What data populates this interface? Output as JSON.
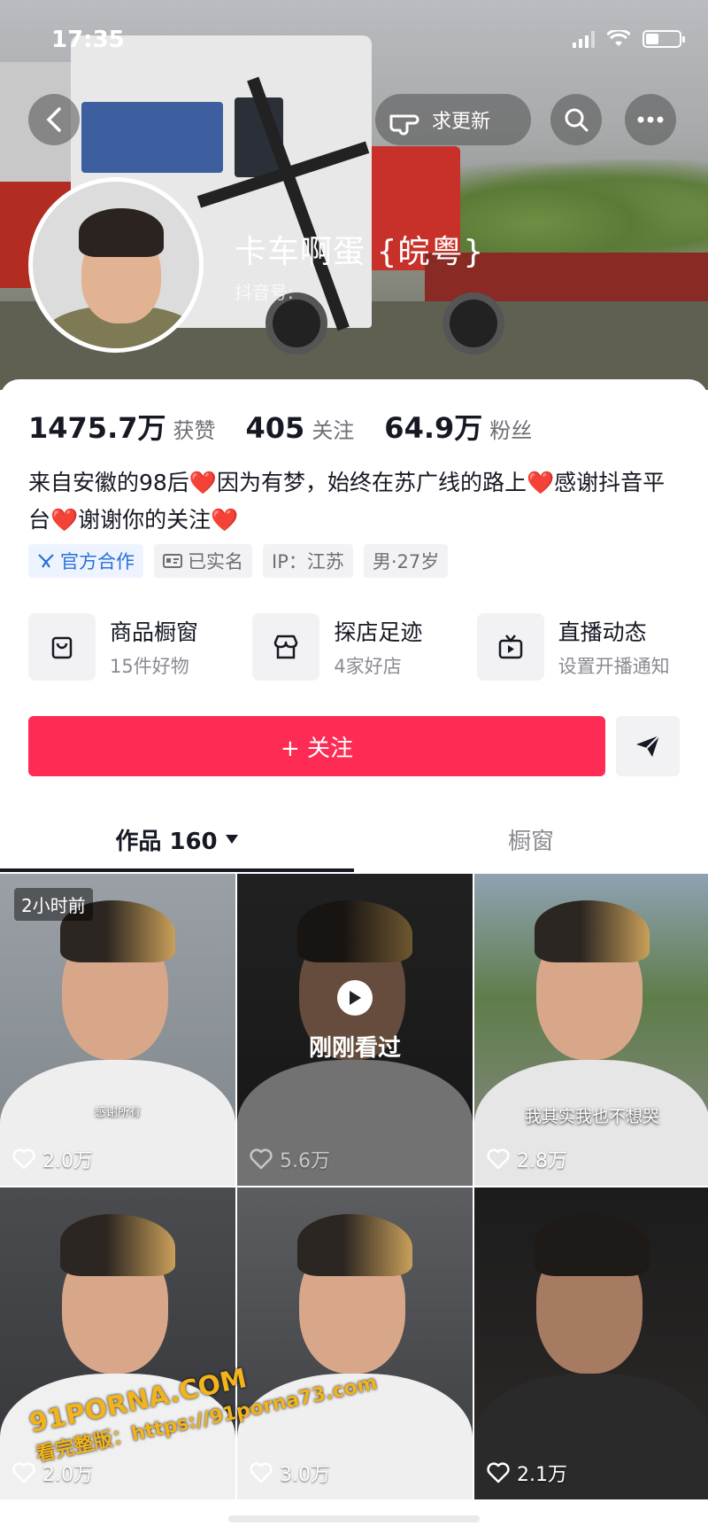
{
  "status_bar": {
    "time": "17:35"
  },
  "header": {
    "update_label": "求更新",
    "name": "卡车啊蛋 {皖粤}",
    "douyin_id_label": "抖音号:"
  },
  "stats": [
    {
      "value": "1475.7万",
      "label": "获赞"
    },
    {
      "value": "405",
      "label": "关注"
    },
    {
      "value": "64.9万",
      "label": "粉丝"
    }
  ],
  "bio": "来自安徽的98后❤️因为有梦，始终在苏广线的路上❤️感谢抖音平台❤️谢谢你的关注❤️",
  "tags": [
    {
      "icon": "official-icon",
      "label": "官方合作"
    },
    {
      "icon": "id-card-icon",
      "label": "已实名"
    },
    {
      "icon": "",
      "label": "IP：江苏"
    },
    {
      "icon": "",
      "label": "男·27岁"
    }
  ],
  "features": [
    {
      "icon": "bag-icon",
      "title": "商品橱窗",
      "sub": "15件好物"
    },
    {
      "icon": "shop-icon",
      "title": "探店足迹",
      "sub": "4家好店"
    },
    {
      "icon": "live-tv-icon",
      "title": "直播动态",
      "sub": "设置开播通知"
    }
  ],
  "follow_label": "+ 关注",
  "tabs": {
    "works": "作品 160",
    "showcase": "橱窗"
  },
  "videos": [
    {
      "likes": "2.0万",
      "badge": "2小时前",
      "subtitle": "感谢所有"
    },
    {
      "likes": "5.6万",
      "watched": "刚刚看过"
    },
    {
      "likes": "2.8万",
      "subtitle": "我其实我也不想哭"
    },
    {
      "likes": "2.0万"
    },
    {
      "likes": "3.0万"
    },
    {
      "likes": "2.1万"
    }
  ],
  "watermark": {
    "line1": "91PORNA.COM",
    "line2": "看完整版：https://91porna73.com"
  },
  "colors": {
    "accent": "#fe2c55",
    "official": "#2a6fd6"
  }
}
